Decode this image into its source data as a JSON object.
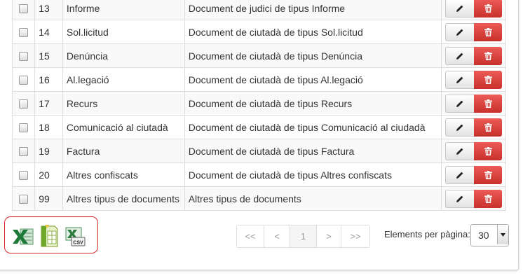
{
  "rows": [
    {
      "code": "13",
      "name": "Informe",
      "description": "Document de judici de tipus Informe"
    },
    {
      "code": "14",
      "name": "Sol.licitud",
      "description": "Document de ciutadà de tipus Sol.licitud"
    },
    {
      "code": "15",
      "name": "Denúncia",
      "description": "Document de ciutadà de tipus Denúncia"
    },
    {
      "code": "16",
      "name": "Al.legació",
      "description": "Document de ciutadà de tipus Al.legació"
    },
    {
      "code": "17",
      "name": "Recurs",
      "description": "Document de ciutadà de tipus Recurs"
    },
    {
      "code": "18",
      "name": "Comunicació al ciutadà",
      "description": "Document de ciutadà de tipus Comunicació al ciudadà"
    },
    {
      "code": "19",
      "name": "Factura",
      "description": "Document de ciutadà de tipus Factura"
    },
    {
      "code": "20",
      "name": "Altres confiscats",
      "description": "Document de ciutadà de tipus Altres confiscats"
    },
    {
      "code": "99",
      "name": "Altres tipus de documents",
      "description": "Altres tipus de documents"
    }
  ],
  "row_actions": {
    "edit_icon": "pencil-icon",
    "delete_icon": "trash-icon"
  },
  "export": {
    "excel_icon": "excel-export-icon",
    "spreadsheet_icon": "spreadsheet-export-icon",
    "csv_icon": "csv-export-icon",
    "csv_label": "CSV"
  },
  "pagination": {
    "first": "<<",
    "prev": "<",
    "current": "1",
    "next": ">",
    "last": ">>"
  },
  "per_page": {
    "label": "Elements per pàgina:",
    "value": "30"
  },
  "colors": {
    "delete": "#d9534f",
    "highlight_border": "#d62929",
    "excel_green": "#1f7a3a"
  }
}
